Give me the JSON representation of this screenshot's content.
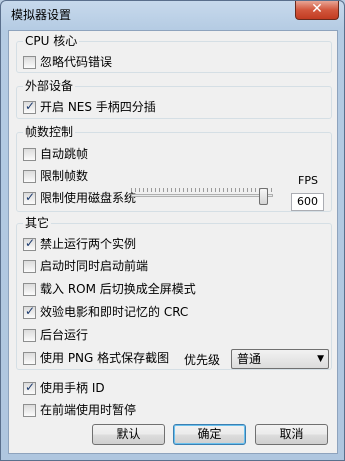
{
  "window": {
    "title": "模拟器设置",
    "close_label": "✕"
  },
  "cpu": {
    "label": "CPU 核心",
    "items": [
      {
        "label": "忽略代码错误",
        "checked": false
      }
    ]
  },
  "external": {
    "label": "外部设备",
    "items": [
      {
        "label": "开启 NES 手柄四分插",
        "checked": true
      }
    ]
  },
  "frame": {
    "label": "帧数控制",
    "items": [
      {
        "label": "自动跳帧",
        "checked": false
      },
      {
        "label": "限制帧数",
        "checked": false
      },
      {
        "label": "限制使用磁盘系统",
        "checked": true
      }
    ],
    "fps_label": "FPS",
    "fps_value": "600",
    "slider_fraction": 0.95
  },
  "other": {
    "label": "其它",
    "items": [
      {
        "label": "禁止运行两个实例",
        "checked": true
      },
      {
        "label": "启动时同时启动前端",
        "checked": false
      },
      {
        "label": "载入 ROM 后切换成全屏模式",
        "checked": false
      },
      {
        "label": "效验电影和即时记忆的 CRC",
        "checked": true
      },
      {
        "label": "后台运行",
        "checked": false
      },
      {
        "label": "使用 PNG 格式保存截图",
        "checked": false
      }
    ],
    "priority_label": "优先级",
    "priority_value": "普通"
  },
  "bottom": {
    "items": [
      {
        "label": "使用手柄 ID",
        "checked": true
      },
      {
        "label": "在前端使用时暂停",
        "checked": false
      }
    ]
  },
  "buttons": {
    "default": "默认",
    "ok": "确定",
    "cancel": "取消"
  }
}
